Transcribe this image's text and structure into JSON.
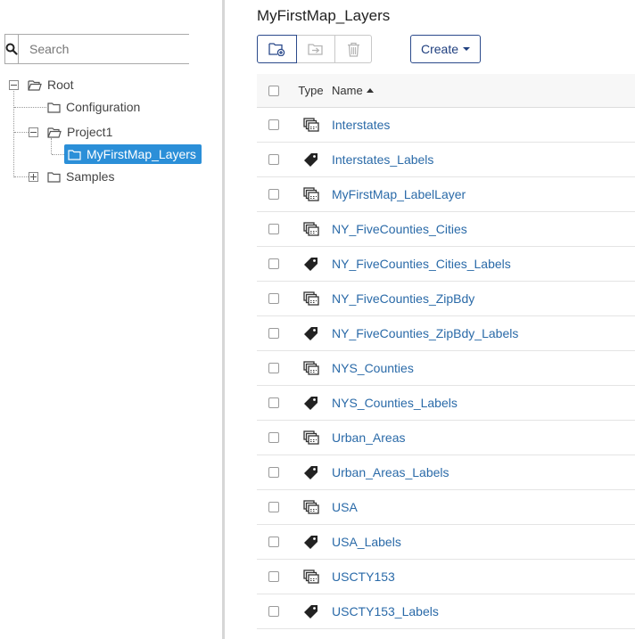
{
  "search": {
    "placeholder": "Search"
  },
  "tree": {
    "root": "Root",
    "configuration": "Configuration",
    "project1": "Project1",
    "selected_folder": "MyFirstMap_Layers",
    "samples": "Samples"
  },
  "page": {
    "title": "MyFirstMap_Layers"
  },
  "toolbar": {
    "create_label": "Create"
  },
  "grid": {
    "columns": {
      "type": "Type",
      "name": "Name"
    },
    "rows": [
      {
        "name": "Interstates",
        "type_icon": "layer-icon"
      },
      {
        "name": "Interstates_Labels",
        "type_icon": "tag-icon"
      },
      {
        "name": "MyFirstMap_LabelLayer",
        "type_icon": "layer-icon"
      },
      {
        "name": "NY_FiveCounties_Cities",
        "type_icon": "layer-icon"
      },
      {
        "name": "NY_FiveCounties_Cities_Labels",
        "type_icon": "tag-icon"
      },
      {
        "name": "NY_FiveCounties_ZipBdy",
        "type_icon": "layer-icon"
      },
      {
        "name": "NY_FiveCounties_ZipBdy_Labels",
        "type_icon": "tag-icon"
      },
      {
        "name": "NYS_Counties",
        "type_icon": "layer-icon"
      },
      {
        "name": "NYS_Counties_Labels",
        "type_icon": "tag-icon"
      },
      {
        "name": "Urban_Areas",
        "type_icon": "layer-icon"
      },
      {
        "name": "Urban_Areas_Labels",
        "type_icon": "tag-icon"
      },
      {
        "name": "USA",
        "type_icon": "layer-icon"
      },
      {
        "name": "USA_Labels",
        "type_icon": "tag-icon"
      },
      {
        "name": "USCTY153",
        "type_icon": "layer-icon"
      },
      {
        "name": "USCTY153_Labels",
        "type_icon": "tag-icon"
      }
    ]
  },
  "colors": {
    "selected": "#2b8fd8",
    "link": "#2a6aa8",
    "primary_border": "#2b4a8b"
  }
}
